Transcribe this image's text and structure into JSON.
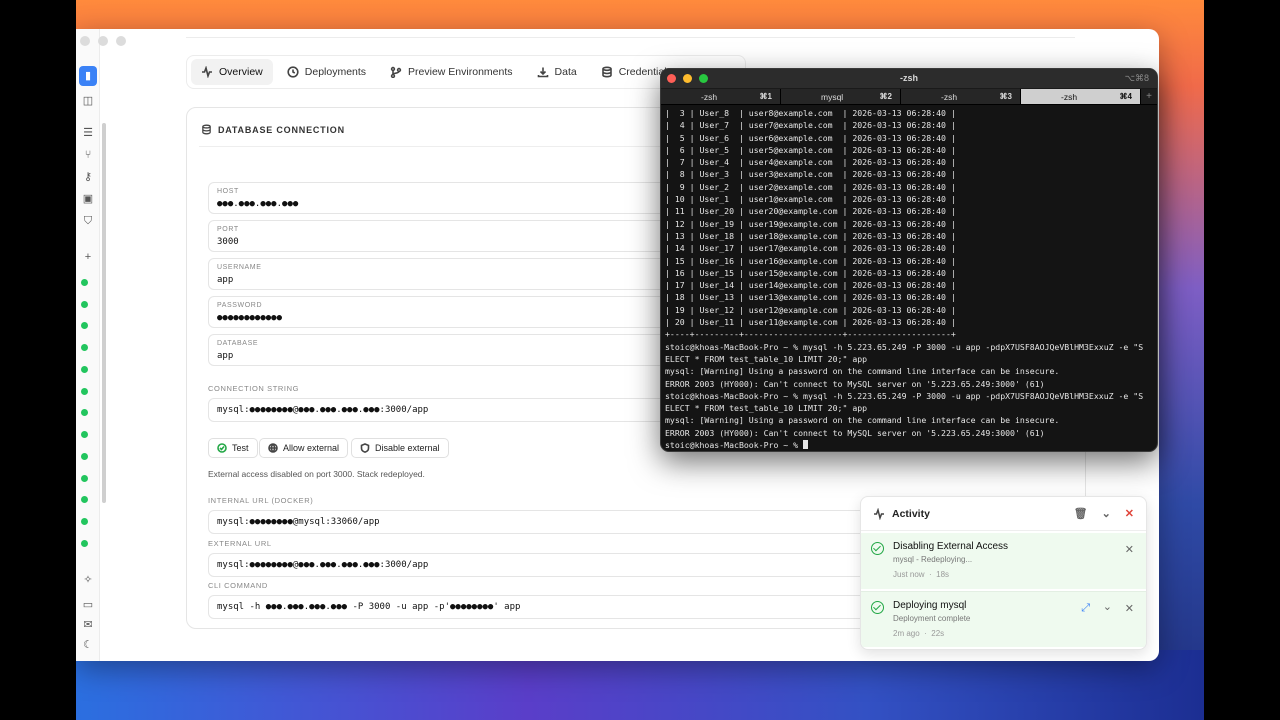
{
  "tabs": [
    {
      "label": "Overview",
      "icon": "activity-icon"
    },
    {
      "label": "Deployments",
      "icon": "clock-icon"
    },
    {
      "label": "Preview Environments",
      "icon": "git-branch-icon"
    },
    {
      "label": "Data",
      "icon": "download-icon"
    },
    {
      "label": "Credentials",
      "icon": "database-icon"
    }
  ],
  "panel": {
    "title": "DATABASE CONNECTION",
    "fields": [
      {
        "label": "HOST",
        "value": "●●●.●●●.●●●.●●●"
      },
      {
        "label": "PORT",
        "value": "3000"
      },
      {
        "label": "USERNAME",
        "value": "app"
      },
      {
        "label": "PASSWORD",
        "value": "●●●●●●●●●●●●"
      },
      {
        "label": "DATABASE",
        "value": "app"
      }
    ],
    "connection_string_label": "CONNECTION STRING",
    "connection_string": "mysql:●●●●●●●●@●●●.●●●.●●●.●●●:3000/app",
    "buttons": {
      "test": "Test",
      "allow": "Allow external",
      "disable": "Disable external"
    },
    "note": "External access disabled on port 3000. Stack redeployed.",
    "internal_url_label": "INTERNAL URL (DOCKER)",
    "internal_url": "mysql:●●●●●●●●@mysql:33060/app",
    "external_url_label": "EXTERNAL URL",
    "external_url": "mysql:●●●●●●●●@●●●.●●●.●●●.●●●:3000/app",
    "cli_label": "CLI COMMAND",
    "cli": "mysql -h ●●●.●●●.●●●.●●● -P 3000 -u app -p'●●●●●●●●' app"
  },
  "terminal": {
    "title": "-zsh",
    "shortcut": "⌥⌘8",
    "tabs": [
      {
        "label": "-zsh",
        "key": "⌘1"
      },
      {
        "label": "mysql",
        "key": "⌘2"
      },
      {
        "label": "-zsh",
        "key": "⌘3"
      },
      {
        "label": "-zsh",
        "key": "⌘4"
      }
    ],
    "lines": [
      "|  3 | User_8  | user8@example.com  | 2026-03-13 06:28:40 |",
      "|  4 | User_7  | user7@example.com  | 2026-03-13 06:28:40 |",
      "|  5 | User_6  | user6@example.com  | 2026-03-13 06:28:40 |",
      "|  6 | User_5  | user5@example.com  | 2026-03-13 06:28:40 |",
      "|  7 | User_4  | user4@example.com  | 2026-03-13 06:28:40 |",
      "|  8 | User_3  | user3@example.com  | 2026-03-13 06:28:40 |",
      "|  9 | User_2  | user2@example.com  | 2026-03-13 06:28:40 |",
      "| 10 | User_1  | user1@example.com  | 2026-03-13 06:28:40 |",
      "| 11 | User_20 | user20@example.com | 2026-03-13 06:28:40 |",
      "| 12 | User_19 | user19@example.com | 2026-03-13 06:28:40 |",
      "| 13 | User_18 | user18@example.com | 2026-03-13 06:28:40 |",
      "| 14 | User_17 | user17@example.com | 2026-03-13 06:28:40 |",
      "| 15 | User_16 | user16@example.com | 2026-03-13 06:28:40 |",
      "| 16 | User_15 | user15@example.com | 2026-03-13 06:28:40 |",
      "| 17 | User_14 | user14@example.com | 2026-03-13 06:28:40 |",
      "| 18 | User_13 | user13@example.com | 2026-03-13 06:28:40 |",
      "| 19 | User_12 | user12@example.com | 2026-03-13 06:28:40 |",
      "| 20 | User_11 | user11@example.com | 2026-03-13 06:28:40 |",
      "+----+---------+--------------------+---------------------+",
      "stoic@khoas-MacBook-Pro ~ % mysql -h 5.223.65.249 -P 3000 -u app -pdpX7USF8AOJQeVBlHM3ExxuZ -e \"S",
      "ELECT * FROM test_table_10 LIMIT 20;\" app",
      "mysql: [Warning] Using a password on the command line interface can be insecure.",
      "ERROR 2003 (HY000): Can't connect to MySQL server on '5.223.65.249:3000' (61)",
      "stoic@khoas-MacBook-Pro ~ % mysql -h 5.223.65.249 -P 3000 -u app -pdpX7USF8AOJQeVBlHM3ExxuZ -e \"S",
      "ELECT * FROM test_table_10 LIMIT 20;\" app",
      "mysql: [Warning] Using a password on the command line interface can be insecure.",
      "ERROR 2003 (HY000): Can't connect to MySQL server on '5.223.65.249:3000' (61)"
    ],
    "prompt": "stoic@khoas-MacBook-Pro ~ % "
  },
  "activity": {
    "title": "Activity",
    "items": [
      {
        "title": "Disabling External Access",
        "subtitle": "mysql - Redeploying...",
        "time": "Just now",
        "duration": "18s"
      },
      {
        "title": "Deploying mysql",
        "subtitle": "Deployment complete",
        "time": "2m ago",
        "duration": "22s"
      }
    ]
  },
  "colors": {
    "accent": "#3b82f6",
    "status_green": "#22c55e",
    "success_bg": "#effaef"
  }
}
